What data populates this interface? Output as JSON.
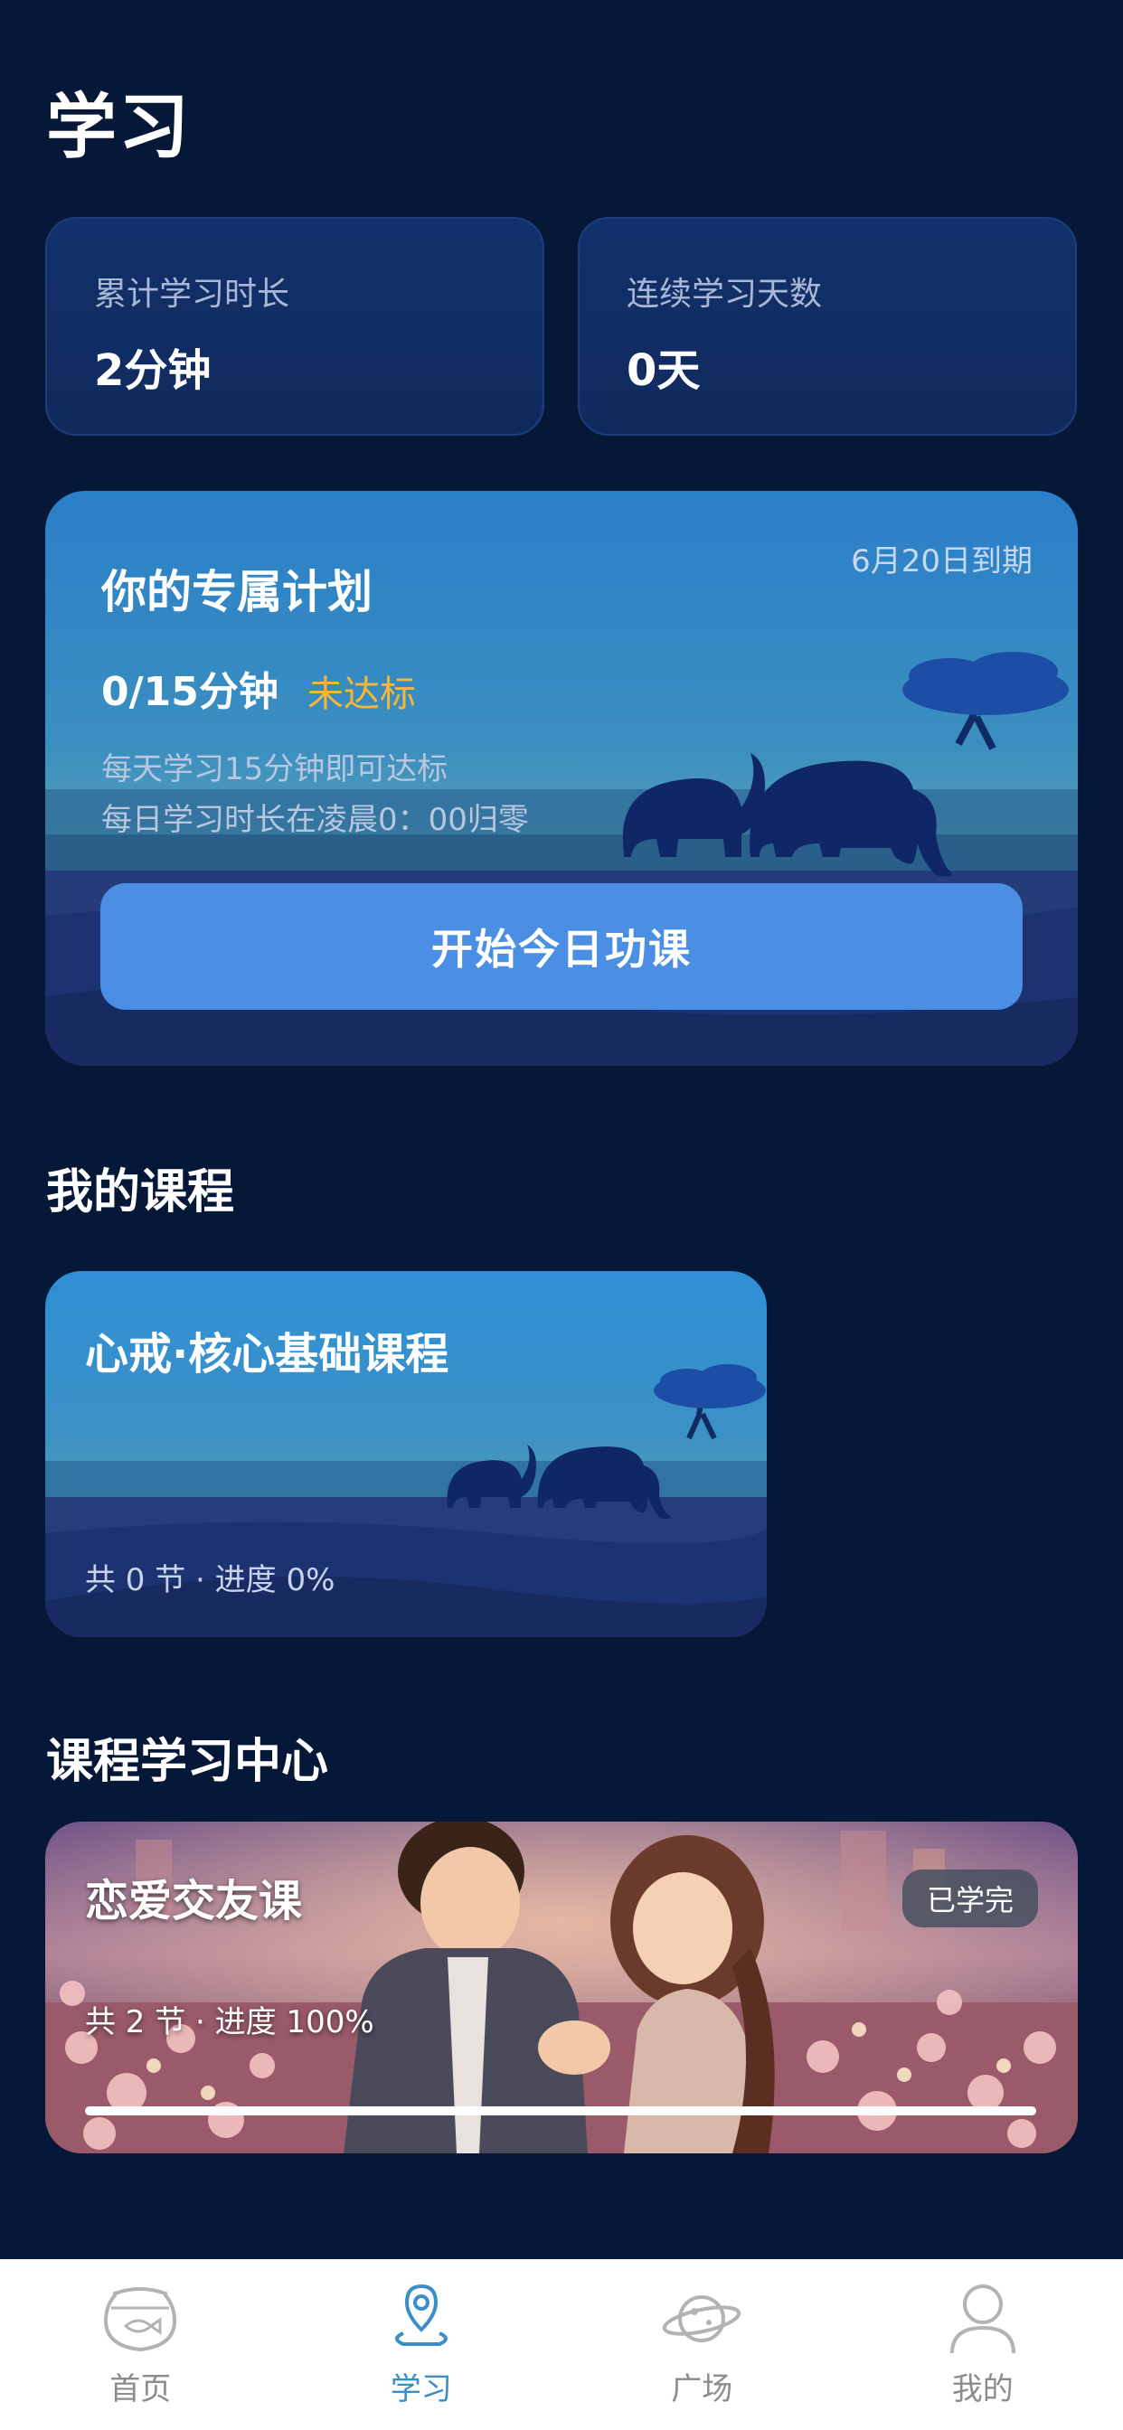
{
  "header": {
    "title": "学习"
  },
  "stats": {
    "total_time": {
      "label": "累计学习时长",
      "value": "2分钟"
    },
    "streak": {
      "label": "连续学习天数",
      "value": "0天"
    }
  },
  "plan": {
    "title": "你的专属计划",
    "expiry": "6月20日到期",
    "progress": "0/15分钟",
    "status": "未达标",
    "rule1": "每天学习15分钟即可达标",
    "rule2": "每日学习时长在凌晨0：00归零",
    "button_label": "开始今日功课"
  },
  "my_courses": {
    "section_title": "我的课程",
    "items": [
      {
        "title": "心戒·核心基础课程",
        "meta": "共 0 节 · 进度 0%"
      }
    ]
  },
  "course_center": {
    "section_title": "课程学习中心",
    "items": [
      {
        "title": "恋爱交友课",
        "meta": "共 2 节 · 进度 100%",
        "badge": "已学完",
        "progress": 1.0
      }
    ]
  },
  "tabbar": {
    "items": [
      {
        "label": "首页",
        "icon": "fishbowl-icon",
        "active": false
      },
      {
        "label": "学习",
        "icon": "location-pin-icon",
        "active": true
      },
      {
        "label": "广场",
        "icon": "planet-icon",
        "active": false
      },
      {
        "label": "我的",
        "icon": "user-icon",
        "active": false
      }
    ]
  },
  "colors": {
    "background": "#061838",
    "accent_button": "#4a8fe4",
    "status_warning": "#f4b63a",
    "tab_active": "#3a8fc8",
    "tab_inactive": "#8c8c8c"
  }
}
